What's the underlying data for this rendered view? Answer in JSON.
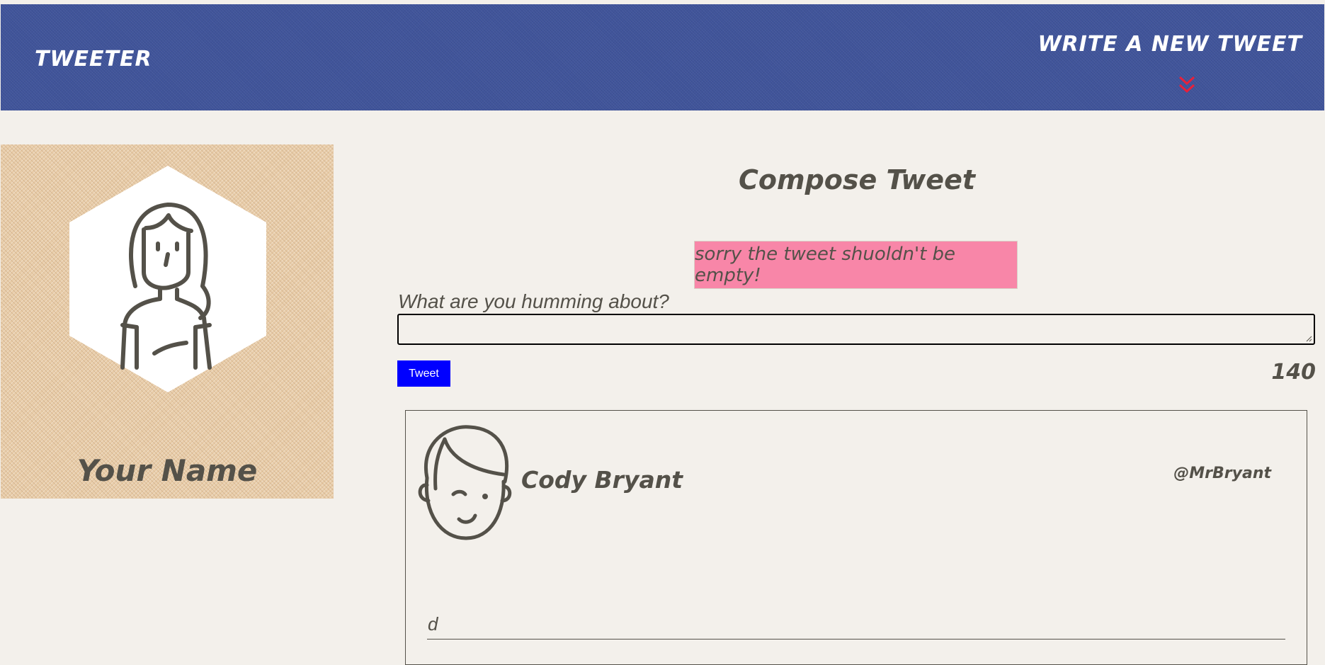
{
  "nav": {
    "brand": "TWEETER",
    "write_link": "WRITE A NEW TWEET",
    "chevron_icon": "double-chevron-down-icon",
    "accent_color": "#e8203a"
  },
  "profile": {
    "name": "Your Name",
    "avatar_icon": "woman-avatar-icon"
  },
  "compose": {
    "title": "Compose Tweet",
    "error_message": "sorry the tweet shuoldn't be empty!",
    "prompt": "What are you humming about?",
    "textarea_value": "",
    "button_label": "Tweet",
    "counter": "140",
    "button_color": "#0000ff",
    "error_color": "#f886a8"
  },
  "tweets": [
    {
      "name": "Cody Bryant",
      "handle": "@MrBryant",
      "content": "d",
      "avatar_icon": "winking-man-avatar-icon"
    }
  ]
}
